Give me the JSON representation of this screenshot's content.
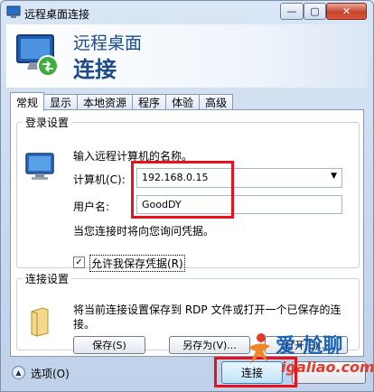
{
  "window": {
    "title": "远程桌面连接",
    "min_glyph": "—",
    "max_glyph": "▢",
    "close_glyph": "✕"
  },
  "header": {
    "line1": "远程桌面",
    "line2": "连接"
  },
  "tabs": [
    {
      "label": "常规",
      "active": true
    },
    {
      "label": "显示",
      "active": false
    },
    {
      "label": "本地资源",
      "active": false
    },
    {
      "label": "程序",
      "active": false
    },
    {
      "label": "体验",
      "active": false
    },
    {
      "label": "高级",
      "active": false
    }
  ],
  "login": {
    "legend": "登录设置",
    "prompt": "输入远程计算机的名称。",
    "computer_label": "计算机(C):",
    "computer_value": "192.168.0.15",
    "username_label": "用户名:",
    "username_value": "GoodDY",
    "credential_note": "当您连接时将向您询问凭据。",
    "save_creds_label": "允许我保存凭据(R)",
    "save_creds_checked": true,
    "check_glyph": "✓"
  },
  "connection": {
    "legend": "连接设置",
    "description": "将当前连接设置保存到 RDP 文件或打开一个已保存的连接。",
    "save_label": "保存(S)",
    "saveas_label": "另存为(V)...",
    "open_label": "打开(E)..."
  },
  "footer": {
    "options_label": "选项(O)",
    "options_glyph": "▲",
    "connect_label": "连接"
  },
  "watermark": {
    "brand": "爱·尬聊",
    "url": "igaliao.com"
  },
  "colors": {
    "highlight_box": "#e8121e",
    "header_text": "#1d4b8a"
  },
  "icons": [
    "rdp-monitor-icon",
    "folder-document-icon",
    "options-arrow-icon"
  ]
}
